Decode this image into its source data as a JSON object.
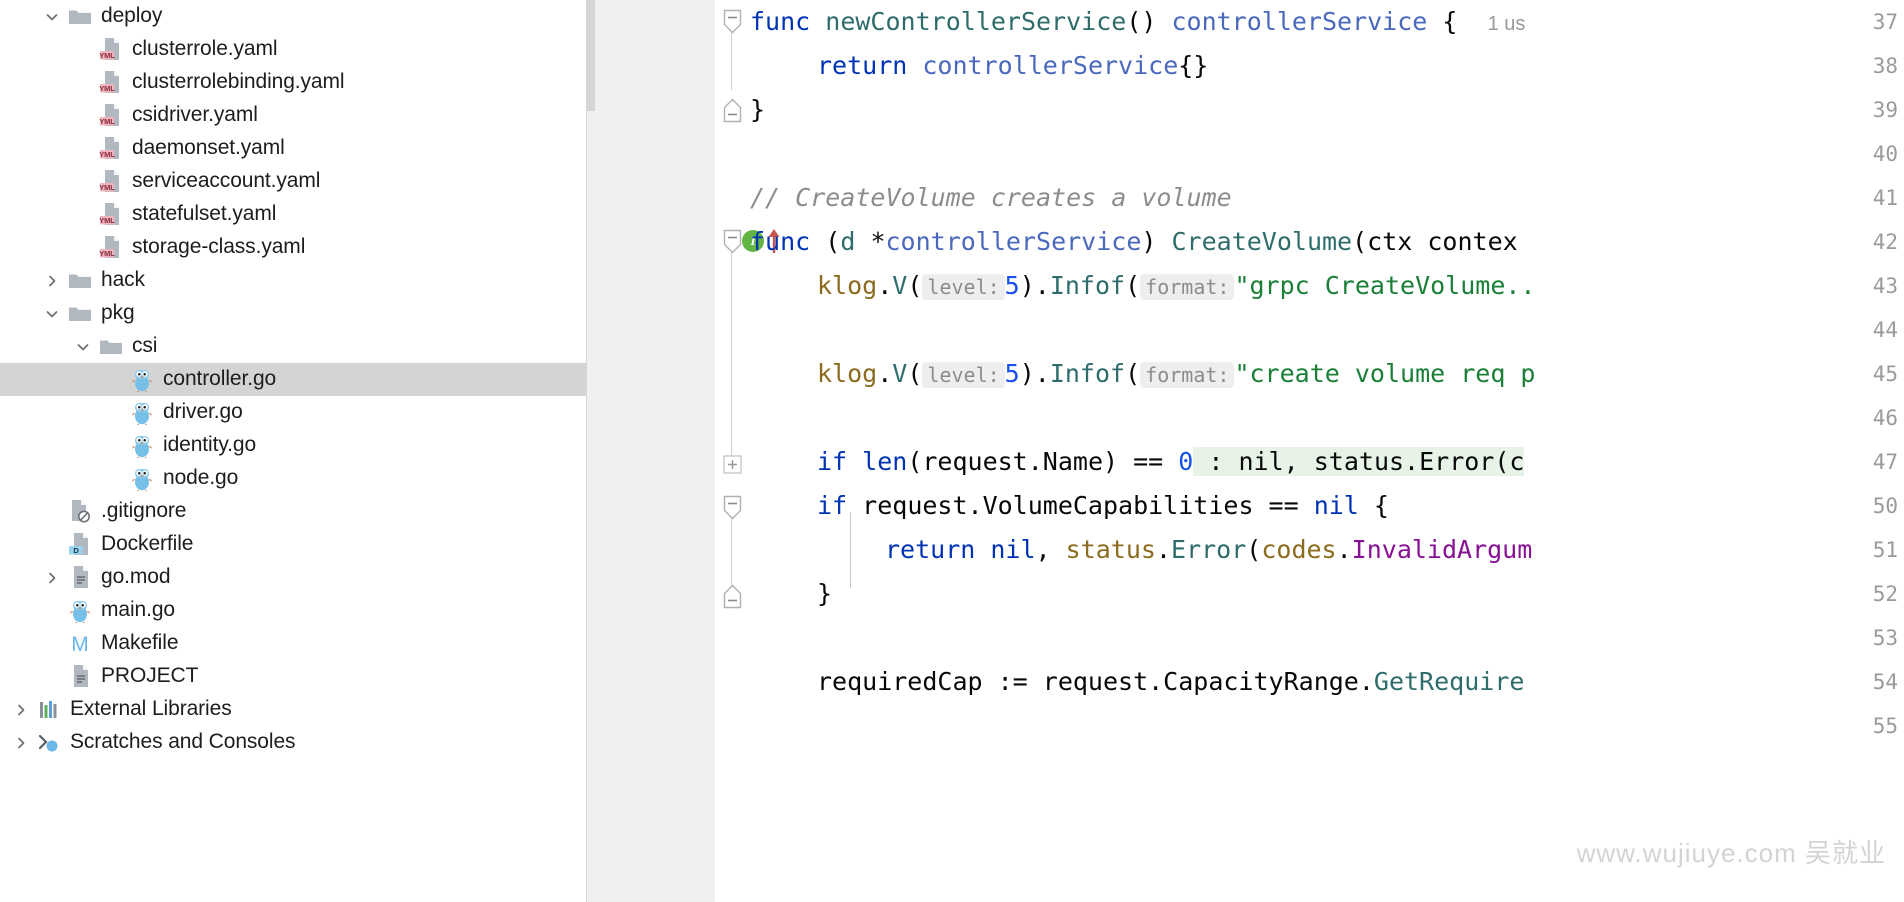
{
  "project_tree": {
    "items": [
      {
        "label": "deploy",
        "indent": 1,
        "twisty": "chevron-down",
        "icon": "folder-icon",
        "selected": false
      },
      {
        "label": "clusterrole.yaml",
        "indent": 2,
        "twisty": "none",
        "icon": "yaml-file-icon",
        "selected": false
      },
      {
        "label": "clusterrolebinding.yaml",
        "indent": 2,
        "twisty": "none",
        "icon": "yaml-file-icon",
        "selected": false
      },
      {
        "label": "csidriver.yaml",
        "indent": 2,
        "twisty": "none",
        "icon": "yaml-file-icon",
        "selected": false
      },
      {
        "label": "daemonset.yaml",
        "indent": 2,
        "twisty": "none",
        "icon": "yaml-file-icon",
        "selected": false
      },
      {
        "label": "serviceaccount.yaml",
        "indent": 2,
        "twisty": "none",
        "icon": "yaml-file-icon",
        "selected": false
      },
      {
        "label": "statefulset.yaml",
        "indent": 2,
        "twisty": "none",
        "icon": "yaml-file-icon",
        "selected": false
      },
      {
        "label": "storage-class.yaml",
        "indent": 2,
        "twisty": "none",
        "icon": "yaml-file-icon",
        "selected": false
      },
      {
        "label": "hack",
        "indent": 1,
        "twisty": "chevron-right",
        "icon": "folder-icon",
        "selected": false
      },
      {
        "label": "pkg",
        "indent": 1,
        "twisty": "chevron-down",
        "icon": "folder-icon",
        "selected": false
      },
      {
        "label": "csi",
        "indent": 2,
        "twisty": "chevron-down",
        "icon": "folder-icon",
        "selected": false
      },
      {
        "label": "controller.go",
        "indent": 3,
        "twisty": "none",
        "icon": "go-file-icon",
        "selected": true
      },
      {
        "label": "driver.go",
        "indent": 3,
        "twisty": "none",
        "icon": "go-file-icon",
        "selected": false
      },
      {
        "label": "identity.go",
        "indent": 3,
        "twisty": "none",
        "icon": "go-file-icon",
        "selected": false
      },
      {
        "label": "node.go",
        "indent": 3,
        "twisty": "none",
        "icon": "go-file-icon",
        "selected": false
      },
      {
        "label": ".gitignore",
        "indent": 1,
        "twisty": "none",
        "icon": "gitignore-file-icon",
        "selected": false
      },
      {
        "label": "Dockerfile",
        "indent": 1,
        "twisty": "none",
        "icon": "dockerfile-icon",
        "selected": false
      },
      {
        "label": "go.mod",
        "indent": 1,
        "twisty": "chevron-right",
        "icon": "text-file-icon",
        "selected": false
      },
      {
        "label": "main.go",
        "indent": 1,
        "twisty": "none",
        "icon": "go-file-icon",
        "selected": false
      },
      {
        "label": "Makefile",
        "indent": 1,
        "twisty": "none",
        "icon": "makefile-icon",
        "selected": false
      },
      {
        "label": "PROJECT",
        "indent": 1,
        "twisty": "none",
        "icon": "text-file-icon",
        "selected": false
      },
      {
        "label": "External Libraries",
        "indent": 0,
        "twisty": "chevron-right",
        "icon": "libraries-icon",
        "selected": false
      },
      {
        "label": "Scratches and Consoles",
        "indent": 0,
        "twisty": "chevron-right",
        "icon": "scratches-icon",
        "selected": false
      }
    ]
  },
  "editor": {
    "line_numbers": [
      "37",
      "38",
      "39",
      "40",
      "41",
      "42",
      "43",
      "44",
      "45",
      "46",
      "47",
      "50",
      "51",
      "52",
      "53",
      "54",
      "55"
    ],
    "gutter_markers": {
      "implemented_label": "I"
    },
    "lines": {
      "l37_kw_func": "func",
      "l37_name": "newControllerService",
      "l37_paren": "() ",
      "l37_ret": "controllerService",
      "l37_brace": " {",
      "l37_usage": "1 us",
      "l38_kw": "return",
      "l38_type": "controllerService",
      "l38_braces": "{}",
      "l39": "}",
      "l41_comment": "// CreateVolume creates a volume",
      "l42_kw_func": "func",
      "l42_open": " (",
      "l42_recv": "d",
      "l42_star": " *",
      "l42_recvtype": "controllerService",
      "l42_close": ") ",
      "l42_method": "CreateVolume",
      "l42_args": "(ctx contex",
      "l43_klog": "klog",
      "l43_dot1": ".",
      "l43_v": "V",
      "l43_p1": "(",
      "l43_hint_level": "level:",
      "l43_five": "5",
      "l43_p2": ").",
      "l43_infof": "Infof",
      "l43_p3": "(",
      "l43_hint_format": "format:",
      "l43_str": "\"grpc CreateVolume..",
      "l45_klog": "klog",
      "l45_dot1": ".",
      "l45_v": "V",
      "l45_p1": "(",
      "l45_hint_level": "level:",
      "l45_five": "5",
      "l45_p2": ").",
      "l45_infof": "Infof",
      "l45_p3": "(",
      "l45_hint_format": "format:",
      "l45_str": "\"create volume req p",
      "l47_if": "if",
      "l47_len": " len",
      "l47_expr": "(request.Name) == ",
      "l47_zero": "0",
      "l47_folded": " : nil, status.Error(c",
      "l50_if": "if",
      "l50_expr": " request.VolumeCapabilities == ",
      "l50_nil": "nil",
      "l50_brace": " {",
      "l51_return": "return",
      "l51_nil": " nil",
      "l51_comma": ", ",
      "l51_status": "status",
      "l51_dot": ".",
      "l51_error": "Error",
      "l51_p": "(",
      "l51_codes": "codes",
      "l51_dot2": ".",
      "l51_invalid": "InvalidArgum",
      "l52": "}",
      "l54_var": "requiredCap := request.CapacityRange.",
      "l54_method": "GetRequire"
    }
  },
  "watermark": {
    "text": "www.wujiuye.com  吴就业"
  },
  "colors": {
    "selection": "#d4d4d4",
    "gutter_bg": "#f0f0f0",
    "keyword": "#0033b3",
    "string": "#1a7f37",
    "comment": "#8c8c8c",
    "number": "#1750eb",
    "type": "#4a69bd",
    "function": "#2e6d6b",
    "folded_highlight": "#e7f3e7",
    "yaml_badge": "#f0b4be",
    "docker_badge": "#9cd2ee",
    "go_gopher": "#6ab7e8",
    "impl_marker": "#62b543",
    "override_arrow": "#c75450"
  }
}
